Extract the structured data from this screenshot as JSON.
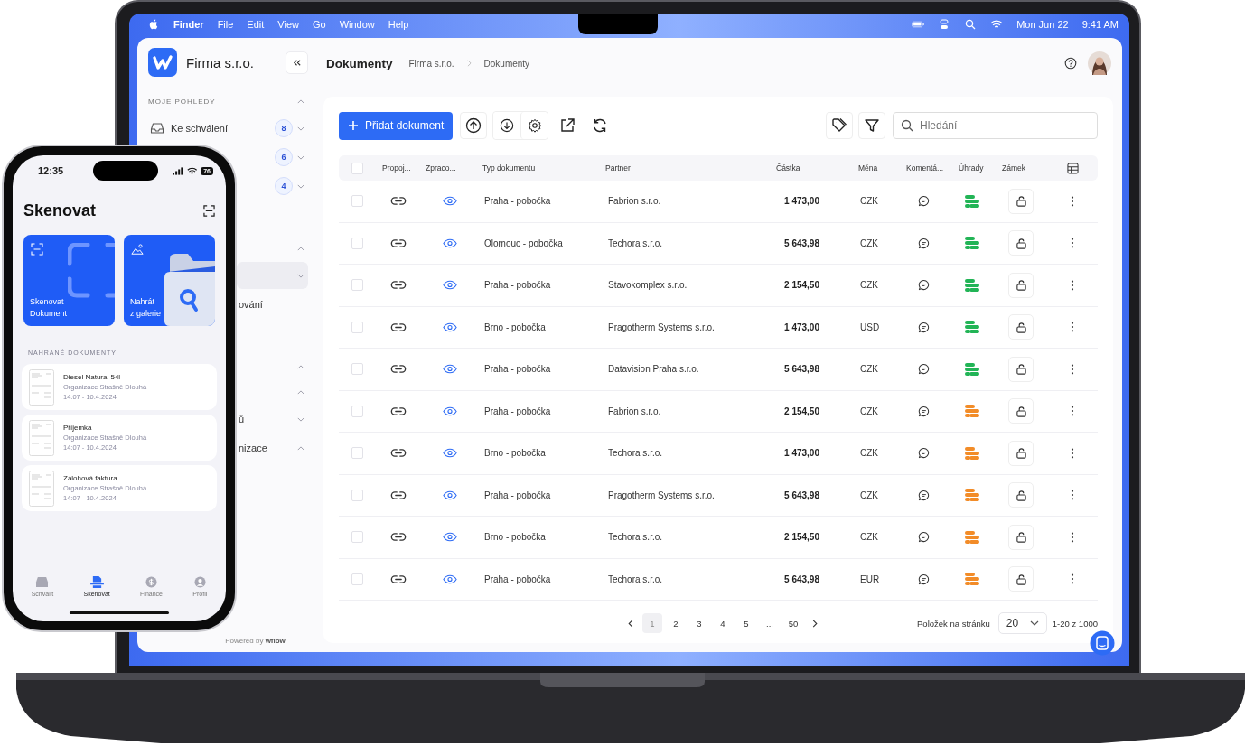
{
  "menu_bar": {
    "app": "Finder",
    "menus": [
      "File",
      "Edit",
      "View",
      "Go",
      "Window",
      "Help"
    ],
    "date": "Mon Jun 22",
    "time": "9:41 AM"
  },
  "sidebar": {
    "org": "Firma s.r.o.",
    "entries": [
      {
        "kind": "section",
        "label": "MOJE POHLEDY",
        "expanded": true
      },
      {
        "kind": "item",
        "label": "Ke schválení",
        "badge": "8",
        "expanded": false,
        "selected": false
      },
      {
        "kind": "covered",
        "badge": "6",
        "expanded": false,
        "selected": false
      },
      {
        "kind": "covered",
        "badge": "4",
        "expanded": false,
        "selected": false
      },
      {
        "kind": "section",
        "expanded": true
      },
      {
        "kind": "covered",
        "expanded": false,
        "selected": true
      },
      {
        "kind": "covered",
        "label": "ování",
        "selected": false
      },
      {
        "kind": "section",
        "expanded": true
      },
      {
        "kind": "section",
        "expanded": true
      },
      {
        "kind": "covered",
        "label": "ů",
        "expanded": false,
        "selected": false
      },
      {
        "kind": "covered",
        "label": "nizace",
        "expanded": true,
        "selected": false
      }
    ],
    "footer_prefix": "Powered by",
    "footer_brand": "wflow"
  },
  "header": {
    "title": "Dokumenty",
    "breadcrumb": [
      "Firma s.r.o.",
      "Dokumenty"
    ]
  },
  "toolbar": {
    "add_label": "Přidat dokument",
    "search_placeholder": "Hledání"
  },
  "table": {
    "select_all_checked": false,
    "columns": [
      "Propoj...",
      "Zpraco...",
      "Typ dokumentu",
      "Partner",
      "Částka",
      "Měna",
      "Komentá...",
      "Úhrady",
      "Zámek"
    ],
    "rows": [
      {
        "checked": false,
        "type": "Praha - pobočka",
        "partner": "Fabrion s.r.o.",
        "amount": "1 473,00",
        "currency": "CZK",
        "color": "#22b456"
      },
      {
        "checked": false,
        "type": "Olomouc - pobočka",
        "partner": "Techora s.r.o.",
        "amount": "5 643,98",
        "currency": "CZK",
        "color": "#22b456"
      },
      {
        "checked": false,
        "type": "Praha - pobočka",
        "partner": "Stavokomplex s.r.o.",
        "amount": "2 154,50",
        "currency": "CZK",
        "color": "#22b456"
      },
      {
        "checked": false,
        "type": "Brno - pobočka",
        "partner": "Pragotherm Systems s.r.o.",
        "amount": "1 473,00",
        "currency": "USD",
        "color": "#22b456"
      },
      {
        "checked": false,
        "type": "Praha - pobočka",
        "partner": "Datavision Praha s.r.o.",
        "amount": "5 643,98",
        "currency": "CZK",
        "color": "#22b456"
      },
      {
        "checked": false,
        "type": "Praha - pobočka",
        "partner": "Fabrion s.r.o.",
        "amount": "2 154,50",
        "currency": "CZK",
        "color": "#f28c28"
      },
      {
        "checked": false,
        "type": "Brno - pobočka",
        "partner": "Techora s.r.o.",
        "amount": "1 473,00",
        "currency": "CZK",
        "color": "#f28c28"
      },
      {
        "checked": false,
        "type": "Praha - pobočka",
        "partner": "Pragotherm Systems s.r.o.",
        "amount": "5 643,98",
        "currency": "CZK",
        "color": "#f28c28"
      },
      {
        "checked": false,
        "type": "Brno - pobočka",
        "partner": "Techora s.r.o.",
        "amount": "2 154,50",
        "currency": "CZK",
        "color": "#f28c28"
      },
      {
        "checked": false,
        "type": "Praha - pobočka",
        "partner": "Techora s.r.o.",
        "amount": "5 643,98",
        "currency": "EUR",
        "color": "#f28c28"
      }
    ]
  },
  "pagination": {
    "pages": [
      {
        "label": "1",
        "selected": true
      },
      {
        "label": "2",
        "selected": false
      },
      {
        "label": "3",
        "selected": false
      },
      {
        "label": "4",
        "selected": false
      },
      {
        "label": "5",
        "selected": false
      },
      {
        "label": "...",
        "selected": false
      },
      {
        "label": "50",
        "selected": false
      }
    ],
    "per_page_label": "Položek na stránku",
    "per_page": "20",
    "range": "1-20 z 1000"
  },
  "phone": {
    "time": "12:35",
    "battery": "76",
    "title": "Skenovat",
    "tiles": [
      {
        "kind": "scan",
        "label": "Skenovat\nDokument"
      },
      {
        "kind": "gallery",
        "label": "Nahrát\nz galerie"
      }
    ],
    "section": "NAHRANÉ DOKUMENTY",
    "documents": [
      {
        "title": "Diesel Natural 54l",
        "org": "Organizace Strašně Dlouhá",
        "date": "14:07 - 10.4.2024"
      },
      {
        "title": "Příjemka",
        "org": "Organizace Strašně Dlouhá",
        "date": "14:07 - 10.4.2024"
      },
      {
        "title": "Zálohová faktura",
        "org": "Organizace Strašně Dlouhá",
        "date": "14:07 - 10.4.2024"
      }
    ],
    "tabs": [
      {
        "kind": "approve",
        "label": "Schválit",
        "selected": false
      },
      {
        "kind": "scan",
        "label": "Skenovat",
        "selected": true
      },
      {
        "kind": "finance",
        "label": "Finance",
        "selected": false
      },
      {
        "kind": "profile",
        "label": "Profil",
        "selected": false
      }
    ]
  }
}
